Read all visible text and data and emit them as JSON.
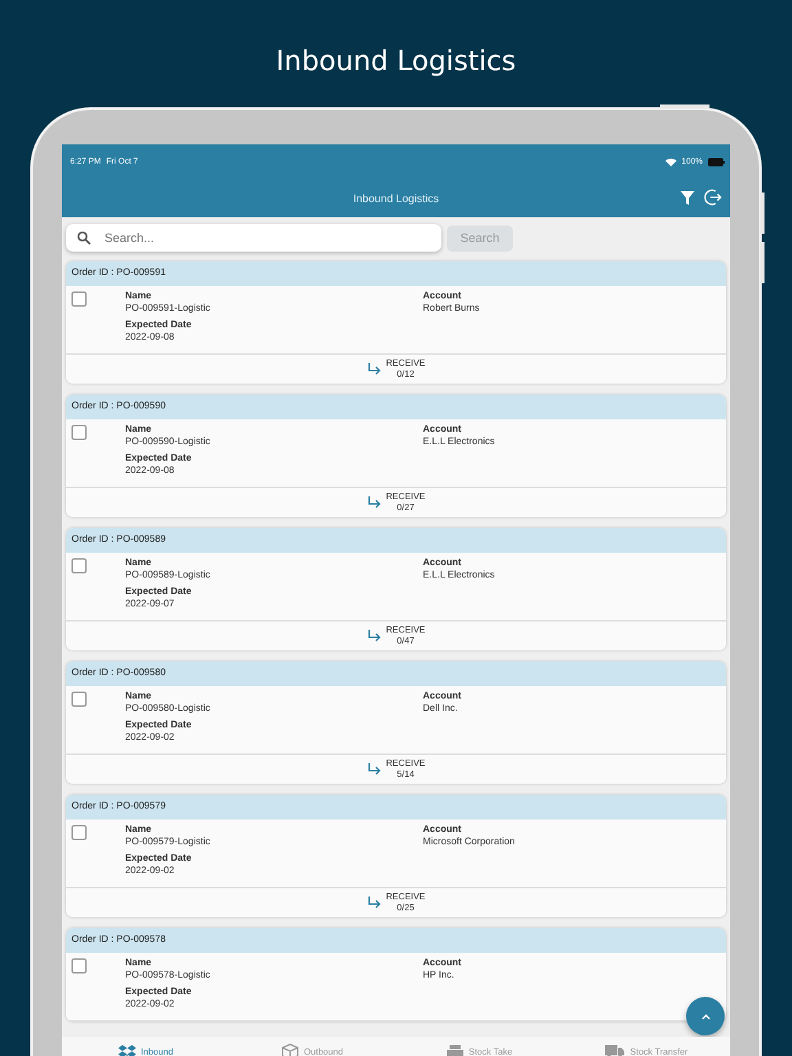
{
  "headline": "Inbound Logistics",
  "status_bar": {
    "time": "6:27 PM",
    "date": "Fri Oct 7",
    "battery": "100%"
  },
  "app_bar": {
    "title": "Inbound Logistics"
  },
  "search": {
    "placeholder": "Search...",
    "button": "Search"
  },
  "orders": [
    {
      "order_label": "Order ID : PO-009591",
      "checked": false,
      "name_label": "Name",
      "name": "PO-009591-Logistic",
      "account_label": "Account",
      "account": "Robert Burns",
      "date_label": "Expected Date",
      "date": "2022-09-08",
      "action": "RECEIVE",
      "count": "0/12"
    },
    {
      "order_label": "Order ID : PO-009590",
      "checked": false,
      "name_label": "Name",
      "name": "PO-009590-Logistic",
      "account_label": "Account",
      "account": "E.L.L Electronics",
      "date_label": "Expected Date",
      "date": "2022-09-08",
      "action": "RECEIVE",
      "count": "0/27"
    },
    {
      "order_label": "Order ID : PO-009589",
      "checked": false,
      "name_label": "Name",
      "name": "PO-009589-Logistic",
      "account_label": "Account",
      "account": "E.L.L Electronics",
      "date_label": "Expected Date",
      "date": "2022-09-07",
      "action": "RECEIVE",
      "count": "0/47"
    },
    {
      "order_label": "Order ID : PO-009580",
      "checked": false,
      "name_label": "Name",
      "name": "PO-009580-Logistic",
      "account_label": "Account",
      "account": "Dell Inc.",
      "date_label": "Expected Date",
      "date": "2022-09-02",
      "action": "RECEIVE",
      "count": "5/14"
    },
    {
      "order_label": "Order ID : PO-009579",
      "checked": false,
      "name_label": "Name",
      "name": "PO-009579-Logistic",
      "account_label": "Account",
      "account": "Microsoft Corporation",
      "date_label": "Expected Date",
      "date": "2022-09-02",
      "action": "RECEIVE",
      "count": "0/25"
    },
    {
      "order_label": "Order ID : PO-009578",
      "checked": false,
      "name_label": "Name",
      "name": "PO-009578-Logistic",
      "account_label": "Account",
      "account": "HP Inc.",
      "date_label": "Expected Date",
      "date": "2022-09-02"
    }
  ],
  "bottom_nav": [
    {
      "kind": "inbound",
      "label": "Inbound",
      "selected": true
    },
    {
      "kind": "outbound",
      "label": "Outbound",
      "selected": false
    },
    {
      "kind": "stocktake",
      "label": "Stock Take",
      "selected": false
    },
    {
      "kind": "transfer",
      "label": "Stock Transfer",
      "selected": false
    }
  ]
}
